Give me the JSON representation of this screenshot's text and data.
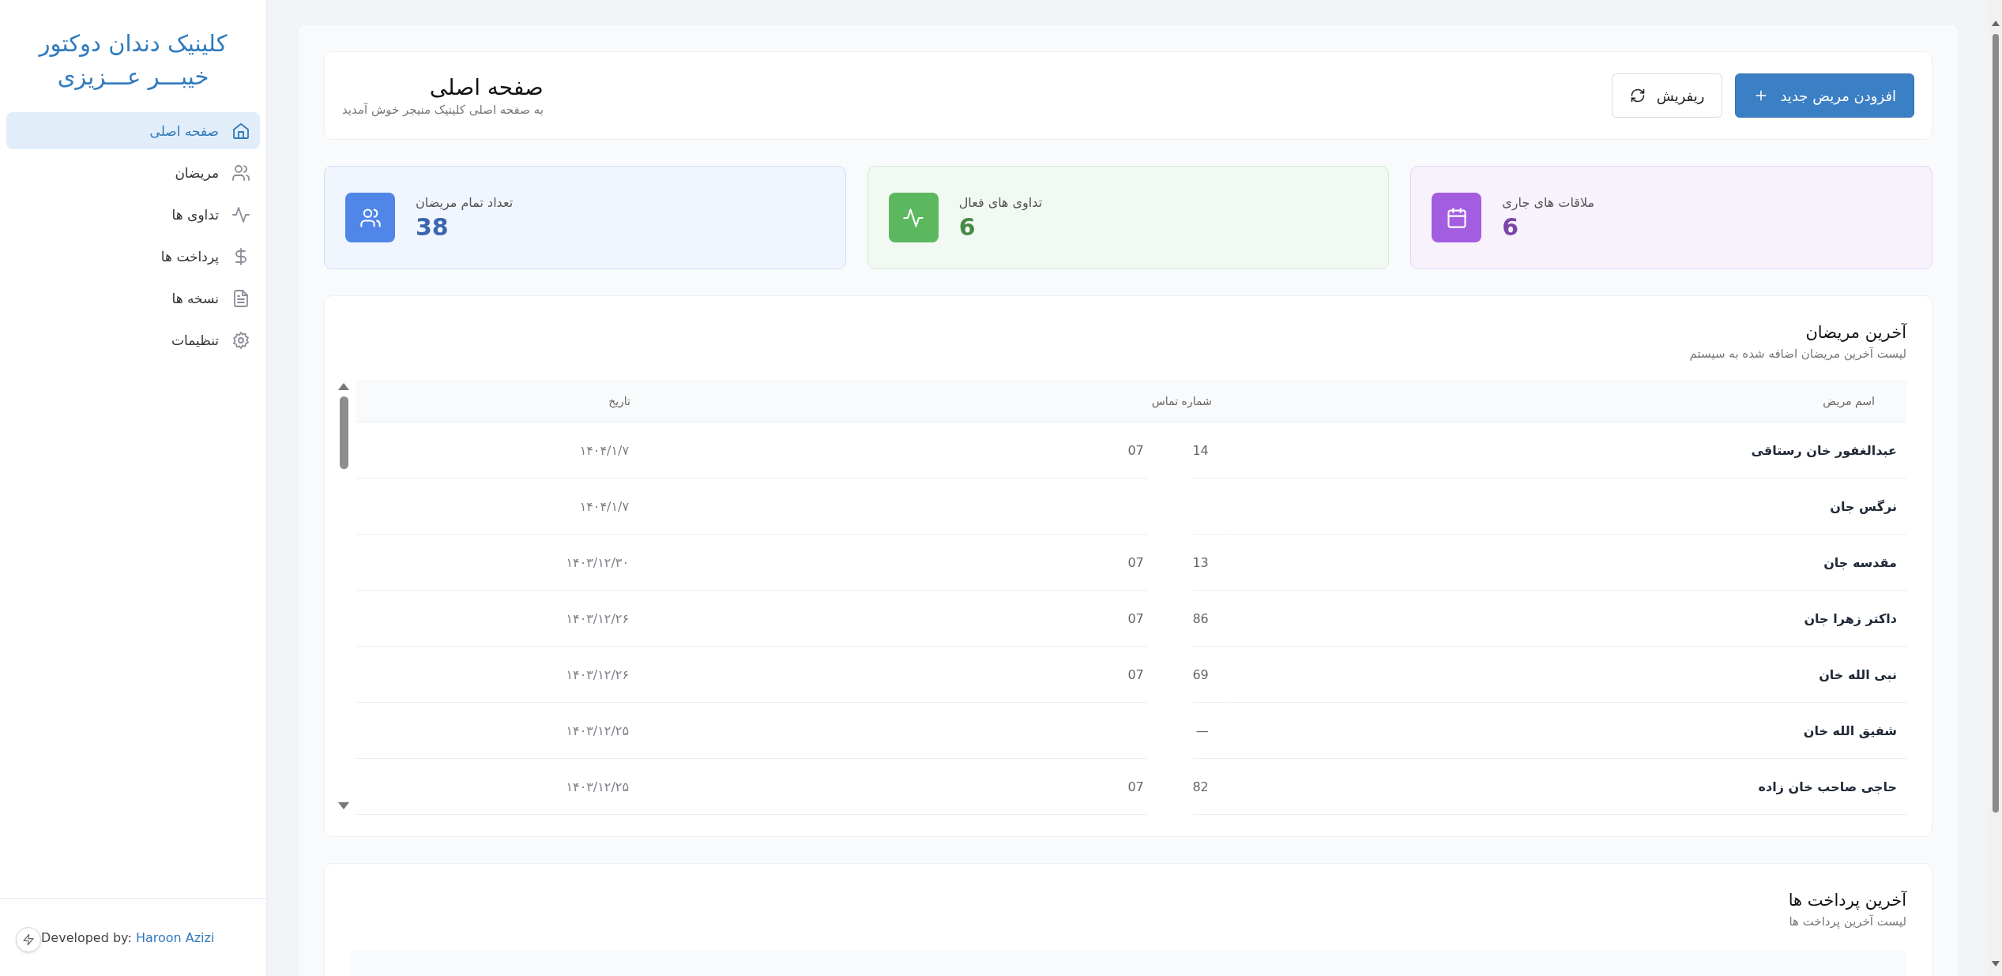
{
  "sidebar": {
    "title": "کلینیک دندان دوکتور\nخیبـــر عـــزیزی",
    "items": [
      {
        "label": "صفحه اصلی",
        "selected": true
      },
      {
        "label": "مریضان",
        "selected": false
      },
      {
        "label": "تداوی ها",
        "selected": false
      },
      {
        "label": "پرداخت ها",
        "selected": false
      },
      {
        "label": "نسخه ها",
        "selected": false
      },
      {
        "label": "تنظیمات",
        "selected": false
      }
    ],
    "footer": {
      "text": "Developed by: ",
      "link": "Haroon Azizi"
    }
  },
  "header": {
    "title": "صفحه اصلی",
    "subtitle": "به صفحه اصلی کلینیک منیجر خوش آمدید",
    "buttons": [
      {
        "label": "افزودن مریض جدید",
        "kind": "primary"
      },
      {
        "label": "ریفریش",
        "kind": "secondary"
      }
    ]
  },
  "stats": [
    {
      "label": "ملاقات های جاری",
      "value": "6",
      "color": "#a35de0"
    },
    {
      "label": "تداوی های فعال",
      "value": "6",
      "color": "#5cb85f"
    },
    {
      "label": "تعداد تمام مریضان",
      "value": "38",
      "color": "#4f86e8"
    }
  ],
  "recent_patients": {
    "title": "آخرین مریضان",
    "subtitle": "لیست آخرین مریضان اضافه شده به سیستم",
    "columns": [
      "اسم مریض",
      "شماره تماس",
      "تاریخ"
    ],
    "rows": [
      {
        "name": "عبدالغفور خان رستاقی",
        "phone_end": "14",
        "phone_start": "07",
        "date": "۱۴۰۴/۱/۷"
      },
      {
        "name": "نرگس جان",
        "date": "۱۴۰۴/۱/۷"
      },
      {
        "name": "مقدسه جان",
        "phone_end": "13",
        "phone_start": "07",
        "date": "۱۴۰۳/۱۲/۳۰"
      },
      {
        "name": "داکتر زهرا جان",
        "phone_end": "86",
        "phone_start": "07",
        "date": "۱۴۰۳/۱۲/۲۶"
      },
      {
        "name": "نبی الله خان",
        "phone_end": "69",
        "phone_start": "07",
        "date": "۱۴۰۳/۱۲/۲۶"
      },
      {
        "name": "شفیق الله خان",
        "phone_end": "—",
        "date": "۱۴۰۳/۱۲/۲۵"
      },
      {
        "name": "حاجی صاحب خان زاده",
        "phone_end": "82",
        "phone_start": "07",
        "date": "۱۴۰۳/۱۲/۲۵"
      }
    ]
  },
  "recent_payments": {
    "title": "آخرین پرداخت ها",
    "subtitle": "لیست آخرین پرداخت ها"
  }
}
